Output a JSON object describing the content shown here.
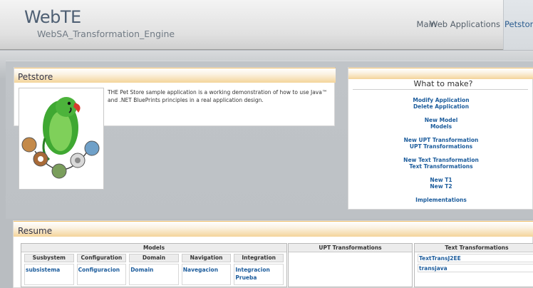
{
  "header": {
    "brand": "WebTE",
    "tagline": "WebSA_Transformation_Engine",
    "nav": [
      "Main",
      "Web Applications"
    ],
    "nav_active": "Petstore"
  },
  "petstore": {
    "title": "Petstore",
    "description": "THE Pet Store sample application is a working demonstration of how to use Java™ and .NET BluePrints principles in a real application design.",
    "image_icon": "parrot-and-pets-illustration"
  },
  "make": {
    "title": "What to make?",
    "groups": [
      [
        "Modify Application",
        "Delete Application"
      ],
      [
        "New Model",
        "Models"
      ],
      [
        "New UPT Transformation",
        "UPT Transformations"
      ],
      [
        "New Text Transformation",
        "Text Transformations"
      ],
      [
        "New T1",
        "New T2"
      ],
      [
        "Implementations"
      ]
    ]
  },
  "resume": {
    "title": "Resume",
    "models": {
      "caption": "Models",
      "columns": [
        "Susbystem",
        "Configuration",
        "Domain",
        "Navigation",
        "Integration"
      ],
      "cells": [
        [
          "subsistema"
        ],
        [
          "Configuracion"
        ],
        [
          "Domain"
        ],
        [
          "Navegacion"
        ],
        [
          "Integracion",
          "Prueba"
        ]
      ]
    },
    "upt": {
      "caption": "UPT Transformations"
    },
    "text": {
      "caption": "Text Transformations",
      "rows": [
        "TextTransJ2EE",
        "transjava"
      ]
    }
  },
  "colors": {
    "link": "#1c5c9c",
    "brand": "#4e5f73",
    "panel_header_accent": "#f4d49a",
    "nav_active": "#2c5d8f"
  }
}
